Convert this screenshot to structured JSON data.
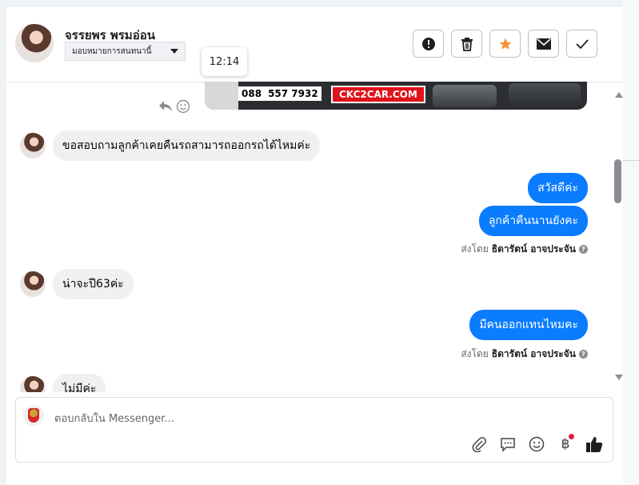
{
  "header": {
    "contact_name": "จรรยพร พรมอ่อน",
    "assign_label": "มอบหมายการสนทนานี้",
    "tooltip_time": "12:14",
    "actions": [
      {
        "icon": "alert-icon",
        "label": "mark-as-spam"
      },
      {
        "icon": "trash-icon",
        "label": "delete"
      },
      {
        "icon": "star-icon",
        "label": "star"
      },
      {
        "icon": "mail-icon",
        "label": "mark-unread"
      },
      {
        "icon": "check-icon",
        "label": "mark-done"
      }
    ]
  },
  "banner": {
    "phone_part1": "088",
    "phone_part2": "557 7932",
    "site": "CKC2CAR.COM"
  },
  "messages": [
    {
      "direction": "in",
      "text": "ขอสอบถามลูกค้าเคยคืนรถสามารถออกรถได้ไหมค่ะ"
    },
    {
      "direction": "out",
      "text": "สวัสดีค่ะ"
    },
    {
      "direction": "out",
      "text": "ลูกค้าคืนนานยังคะ"
    },
    {
      "direction": "in",
      "text": "น่าจะปี63ค่ะ"
    },
    {
      "direction": "out",
      "text": "มีคนออกแทนไหมคะ"
    },
    {
      "direction": "in",
      "text": "ไม่มีค่ะ"
    }
  ],
  "sent_by": {
    "prefix": "ส่งโดย",
    "name": "ธิดารัตน์ อาจประจัน",
    "help": "?"
  },
  "composer": {
    "placeholder": "ตอบกลับใน Messenger...",
    "tools": [
      "paperclip-icon",
      "speech-bubble-icon",
      "smiley-icon",
      "baht-icon",
      "thumbs-up-icon"
    ],
    "baht_glyph": "฿",
    "notification_color": "#e41e3f"
  },
  "colors": {
    "outgoing_bubble": "#0a7cff",
    "incoming_bubble": "#f0f0f0",
    "star": "#f7923a"
  }
}
